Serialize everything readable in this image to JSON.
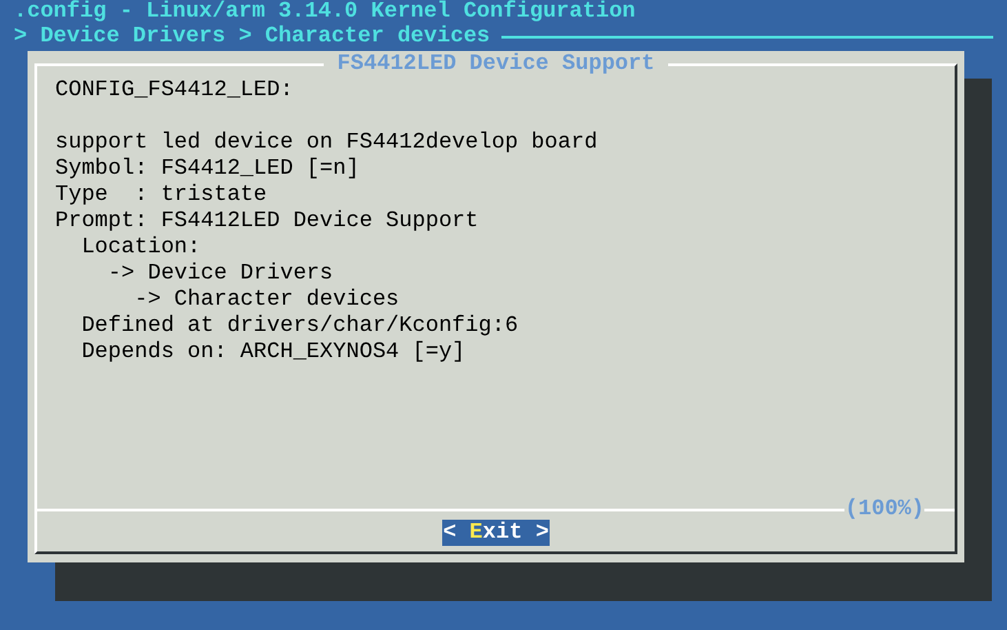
{
  "window": {
    "title": ".config - Linux/arm 3.14.0 Kernel Configuration"
  },
  "breadcrumb": "> Device Drivers > Character devices",
  "dialog": {
    "title": "FS4412LED Device Support",
    "header": "CONFIG_FS4412_LED:",
    "lines": [
      "support led device on FS4412develop board",
      "Symbol: FS4412_LED [=n]",
      "Type  : tristate",
      "Prompt: FS4412LED Device Support",
      "  Location:",
      "    -> Device Drivers",
      "      -> Character devices",
      "  Defined at drivers/char/Kconfig:6",
      "  Depends on: ARCH_EXYNOS4 [=y]"
    ],
    "scroll_percent": "(100%)",
    "buttons": [
      {
        "left": "<",
        "hotkey": "E",
        "rest": "xit",
        "right": ">",
        "selected": true
      }
    ]
  }
}
